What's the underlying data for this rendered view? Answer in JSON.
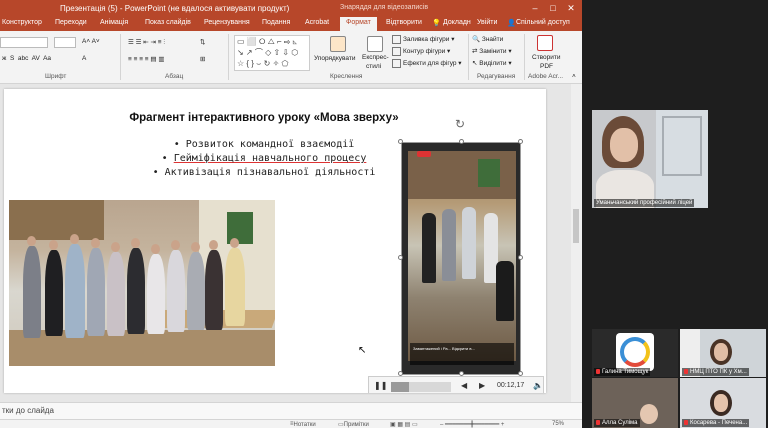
{
  "titlebar": {
    "title": "Презентація (5) - PowerPoint (не вдалося активувати продукт)",
    "tools_label": "Знаряддя для відеозаписів"
  },
  "tabs": [
    "Конструктор",
    "Переходи",
    "Анімація",
    "Показ слайдів",
    "Рецензування",
    "Подання",
    "Acrobat",
    "Формат",
    "Відтворити"
  ],
  "tab_extra": {
    "help": "Докладн",
    "signin": "Увійти",
    "share": "Спільний доступ"
  },
  "ribbon": {
    "groups": {
      "font": "Шрифт",
      "paragraph": "Абзац",
      "drawing": "Креслення",
      "editing": "Редагування",
      "adobe": "Adobe Acr..."
    },
    "arrange": "Упорядкувати",
    "quick_styles_1": "Експрес-",
    "quick_styles_2": "стилі",
    "fill": "Заливка фігури",
    "outline": "Контур фігури",
    "effects": "Ефекти для фігур",
    "find": "Знайти",
    "replace": "Замінити",
    "select": "Виділити",
    "create_pdf_1": "Створити",
    "create_pdf_2": "PDF"
  },
  "slide": {
    "title": "Фрагмент інтерактивного уроку «Мова зверху»",
    "bullets": [
      "Розвиток командної взаємодії",
      "Гейміфікація навчального процесу",
      "Активізація пізнавальної діяльності"
    ]
  },
  "video": {
    "caption": "Завантажений і Ра... Відкрити в..."
  },
  "player": {
    "time": "00:12,17",
    "progress": 0.3
  },
  "notes": {
    "placeholder": "тки до слайда"
  },
  "status": {
    "notes": "Нотатки",
    "comments": "Примітки",
    "zoom": "75%"
  },
  "call": {
    "participants": [
      {
        "name": "Уманьчанський професійний ліцей"
      },
      {
        "name": "Галина Тимощук"
      },
      {
        "name": "НМЦ ПТО ПК у Хм..."
      },
      {
        "name": "Алла Суліма"
      },
      {
        "name": "Косарева - Печена..."
      }
    ]
  },
  "colors": {
    "ppt_accent": "#b7472a",
    "call_bg": "#1e1e1e"
  }
}
